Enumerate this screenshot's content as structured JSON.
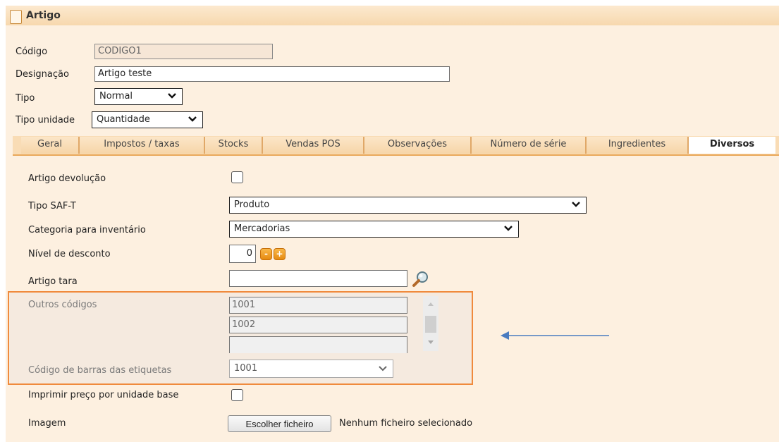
{
  "window": {
    "title": "Artigo"
  },
  "header_fields": {
    "codigo": {
      "label": "Código",
      "value": "CODIGO1"
    },
    "designacao": {
      "label": "Designação",
      "value": "Artigo teste"
    },
    "tipo": {
      "label": "Tipo",
      "value": "Normal"
    },
    "tipo_unidade": {
      "label": "Tipo unidade",
      "value": "Quantidade"
    }
  },
  "tabs": [
    {
      "label": "Geral"
    },
    {
      "label": "Impostos / taxas"
    },
    {
      "label": "Stocks"
    },
    {
      "label": "Vendas POS"
    },
    {
      "label": "Observações"
    },
    {
      "label": "Número de série"
    },
    {
      "label": "Ingredientes"
    },
    {
      "label": "Diversos",
      "active": true
    }
  ],
  "diversos": {
    "artigo_devolucao": {
      "label": "Artigo devolução",
      "checked": false
    },
    "tipo_saft": {
      "label": "Tipo SAF-T",
      "value": "Produto"
    },
    "categoria_inventario": {
      "label": "Categoria para inventário",
      "value": "Mercadorias"
    },
    "nivel_desconto": {
      "label": "Nível de desconto",
      "value": "0",
      "minus": "-",
      "plus": "+"
    },
    "artigo_tara": {
      "label": "Artigo tara",
      "value": ""
    },
    "outros_codigos": {
      "label": "Outros códigos",
      "values": [
        "1001",
        "1002",
        ""
      ]
    },
    "codigo_barras": {
      "label": "Código de barras das etiquetas",
      "value": "1001"
    },
    "imprimir_preco": {
      "label": "Imprimir preço por unidade base",
      "checked": false
    },
    "imagem": {
      "label": "Imagem",
      "button": "Escolher ficheiro",
      "status": "Nenhum ficheiro selecionado"
    }
  },
  "colors": {
    "highlight_border": "#f08a3c",
    "arrow": "#4a7cc0",
    "tab_accent": "#e9a85a"
  }
}
